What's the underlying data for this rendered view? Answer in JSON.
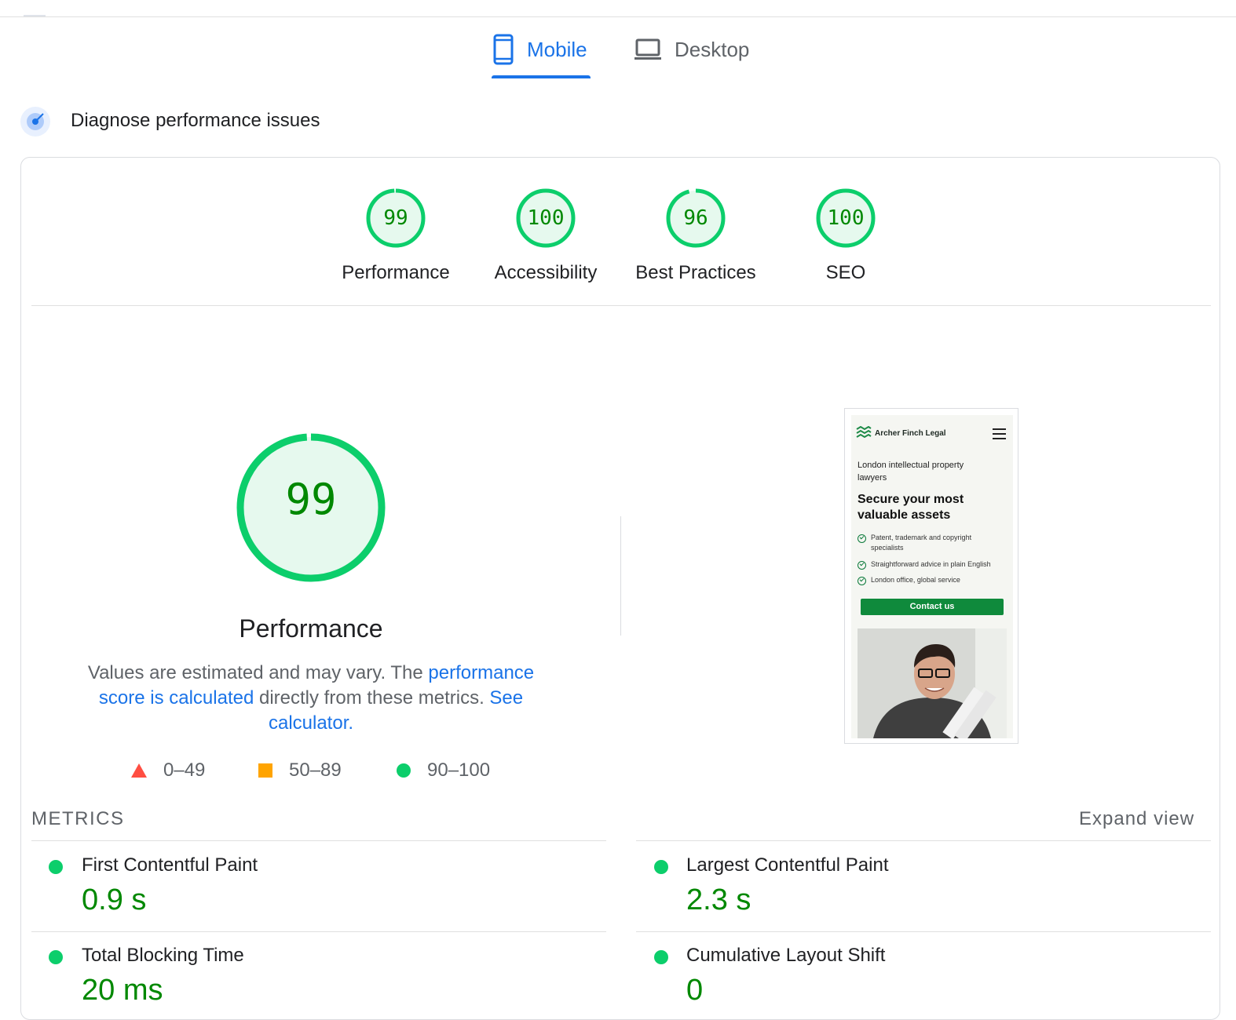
{
  "tabs": {
    "mobile": "Mobile",
    "desktop": "Desktop"
  },
  "diagnose": {
    "title": "Diagnose performance issues"
  },
  "gauges": [
    {
      "label": "Performance",
      "score": "99"
    },
    {
      "label": "Accessibility",
      "score": "100"
    },
    {
      "label": "Best Practices",
      "score": "96"
    },
    {
      "label": "SEO",
      "score": "100"
    }
  ],
  "performance": {
    "score": "99",
    "title": "Performance",
    "desc_1": "Values are estimated and may vary. The ",
    "link_1": "performance score is calculated",
    "desc_2": " directly from these metrics. ",
    "link_2": "See calculator."
  },
  "legend": {
    "fail": "0–49",
    "average": "50–89",
    "pass": "90–100"
  },
  "screenshot": {
    "brand": "Archer Finch Legal",
    "subtitle": "London intellectual property lawyers",
    "headline": "Secure your most valuable assets",
    "bullets": [
      "Patent, trademark and copyright specialists",
      "Straightforward advice in plain English",
      "London office, global service"
    ],
    "button": "Contact us"
  },
  "metrics": {
    "title": "METRICS",
    "expand": "Expand view",
    "items": [
      {
        "name": "First Contentful Paint",
        "value": "0.9 s"
      },
      {
        "name": "Largest Contentful Paint",
        "value": "2.3 s"
      },
      {
        "name": "Total Blocking Time",
        "value": "20 ms"
      },
      {
        "name": "Cumulative Layout Shift",
        "value": "0"
      }
    ]
  },
  "colors": {
    "pass": "#0cce6b",
    "average": "#ffa400",
    "fail": "#ff4e42",
    "link": "#1a73e8",
    "score_text": "#008800"
  }
}
